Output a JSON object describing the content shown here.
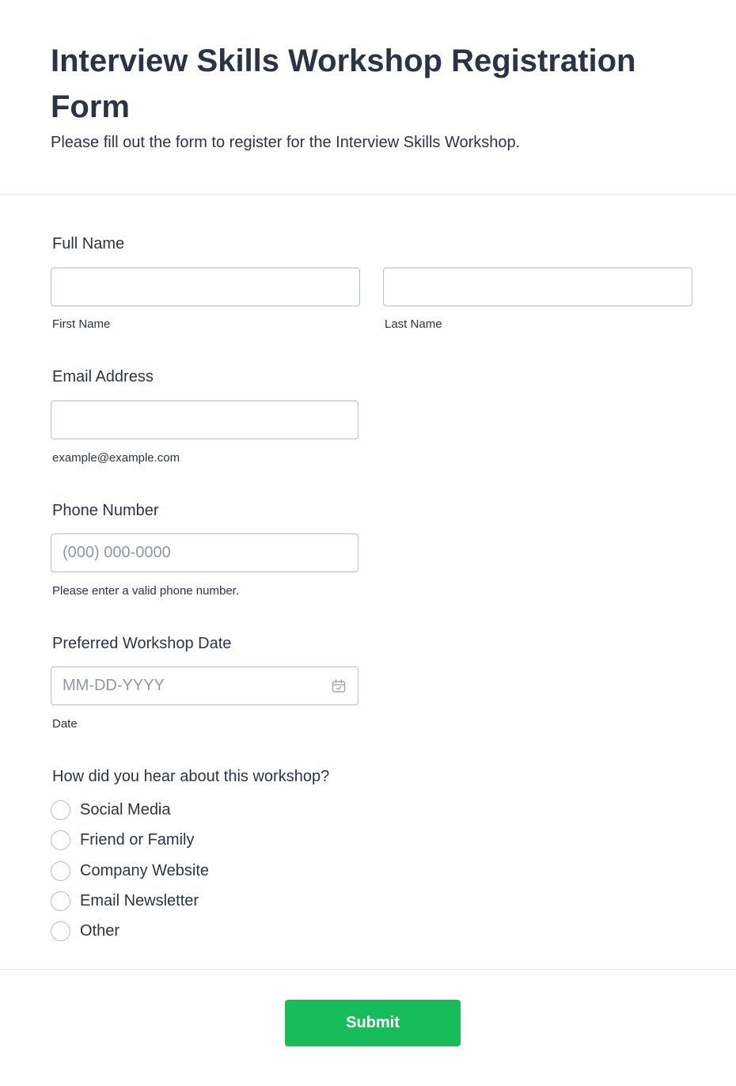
{
  "header": {
    "title": "Interview Skills Workshop Registration Form",
    "subtitle": "Please fill out the form to register for the Interview Skills Workshop."
  },
  "full_name": {
    "label": "Full Name",
    "first_value": "",
    "last_value": "",
    "first_sublabel": "First Name",
    "last_sublabel": "Last Name"
  },
  "email": {
    "label": "Email Address",
    "value": "",
    "sublabel": "example@example.com"
  },
  "phone": {
    "label": "Phone Number",
    "placeholder": "(000) 000-0000",
    "sublabel": "Please enter a valid phone number."
  },
  "workshop_date": {
    "label": "Preferred Workshop Date",
    "placeholder": "MM-DD-YYYY",
    "sublabel": "Date",
    "icon": "calendar-icon"
  },
  "referral": {
    "label": "How did you hear about this workshop?",
    "options": [
      "Social Media",
      "Friend or Family",
      "Company Website",
      "Email Newsletter",
      "Other"
    ]
  },
  "submit": {
    "label": "Submit"
  },
  "colors": {
    "text": "#2c3345",
    "border": "#b8bdc9",
    "submit": "#18bd5b"
  }
}
